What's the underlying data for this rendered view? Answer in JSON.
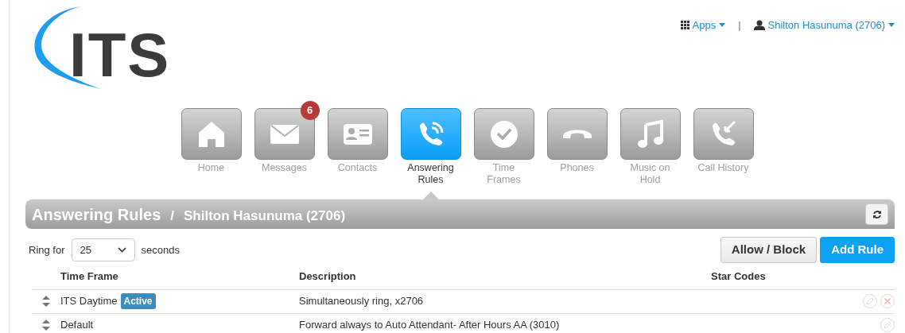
{
  "logo": {
    "text": "ITS"
  },
  "top_menu": {
    "apps": "Apps",
    "separator": "|",
    "user": "Shilton Hasunuma (2706)"
  },
  "nav": [
    {
      "kind": "home",
      "label": "Home",
      "selected": false
    },
    {
      "kind": "messages",
      "label": "Messages",
      "selected": false,
      "badge": "6"
    },
    {
      "kind": "contacts",
      "label": "Contacts",
      "selected": false
    },
    {
      "kind": "answering",
      "label": "Answering\nRules",
      "selected": true
    },
    {
      "kind": "time",
      "label": "Time\nFrames",
      "selected": false
    },
    {
      "kind": "phones",
      "label": "Phones",
      "selected": false
    },
    {
      "kind": "music",
      "label": "Music on\nHold",
      "selected": false
    },
    {
      "kind": "history",
      "label": "Call History",
      "selected": false
    }
  ],
  "header": {
    "title": "Answering Rules",
    "separator": "/",
    "subtitle": "Shilton Hasunuma (2706)"
  },
  "ring": {
    "label": "Ring for",
    "value": "25",
    "unit": "seconds"
  },
  "buttons": [
    {
      "kind": "default",
      "label": "Allow / Block"
    },
    {
      "kind": "primary",
      "label": "Add Rule"
    }
  ],
  "table": {
    "columns": [
      "Time Frame",
      "Description",
      "Star Codes"
    ],
    "rows": [
      {
        "time_frame": "ITS Daytime",
        "badge": "Active",
        "description": "Simultaneously ring, x2706",
        "deletable": true
      },
      {
        "time_frame": "Default",
        "description": "Forward always to Auto Attendant- After Hours AA (3010)",
        "deletable": false
      }
    ]
  }
}
